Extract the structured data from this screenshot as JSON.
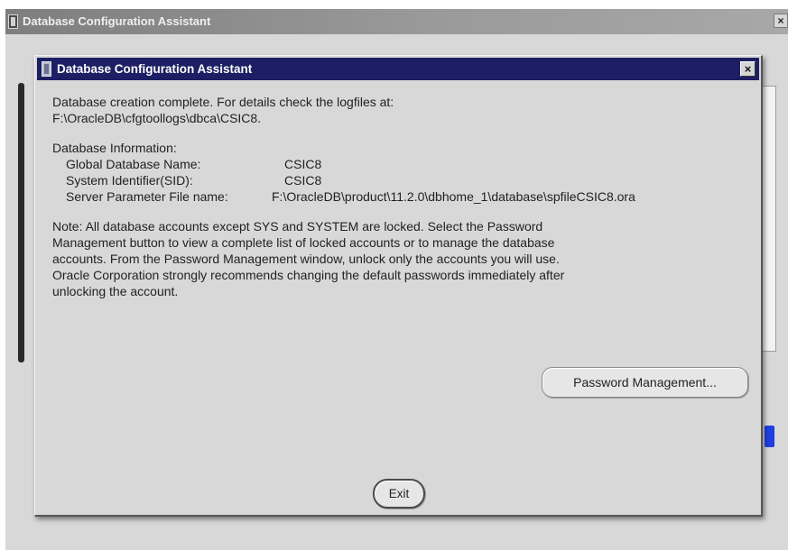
{
  "outer_window": {
    "title": "Database Configuration Assistant",
    "close_glyph": "×"
  },
  "dialog": {
    "title": "Database Configuration Assistant",
    "close_glyph": "×",
    "message_line1": "Database creation complete. For details check the logfiles at:",
    "message_line2": "F:\\OracleDB\\cfgtoollogs\\dbca\\CSIC8.",
    "info_heading": "Database Information:",
    "info": [
      {
        "label": "Global Database Name:",
        "value": "CSIC8"
      },
      {
        "label": "System Identifier(SID):",
        "value": "CSIC8"
      },
      {
        "label": "Server Parameter File name:",
        "value": "F:\\OracleDB\\product\\11.2.0\\dbhome_1\\database\\spfileCSIC8.ora"
      }
    ],
    "note_lines": [
      "Note: All database accounts except SYS and SYSTEM are locked. Select the Password",
      "Management button to view a complete list of locked accounts or to manage the database",
      "accounts. From the Password Management window, unlock only the accounts you will use.",
      "Oracle Corporation strongly recommends changing the default passwords immediately after",
      "unlocking the account."
    ],
    "password_button_label": "Password Management...",
    "exit_button_label": "Exit"
  },
  "icons": {
    "outer_app": "oracle-app-icon",
    "dialog_app": "oracle-app-icon",
    "close": "close-icon"
  },
  "colors": {
    "dialog_titlebar": "#1c1f63",
    "outer_titlebar": "#8a8a8a",
    "window_background": "#d8d8d8",
    "progress_accent": "#1f3fe0"
  }
}
